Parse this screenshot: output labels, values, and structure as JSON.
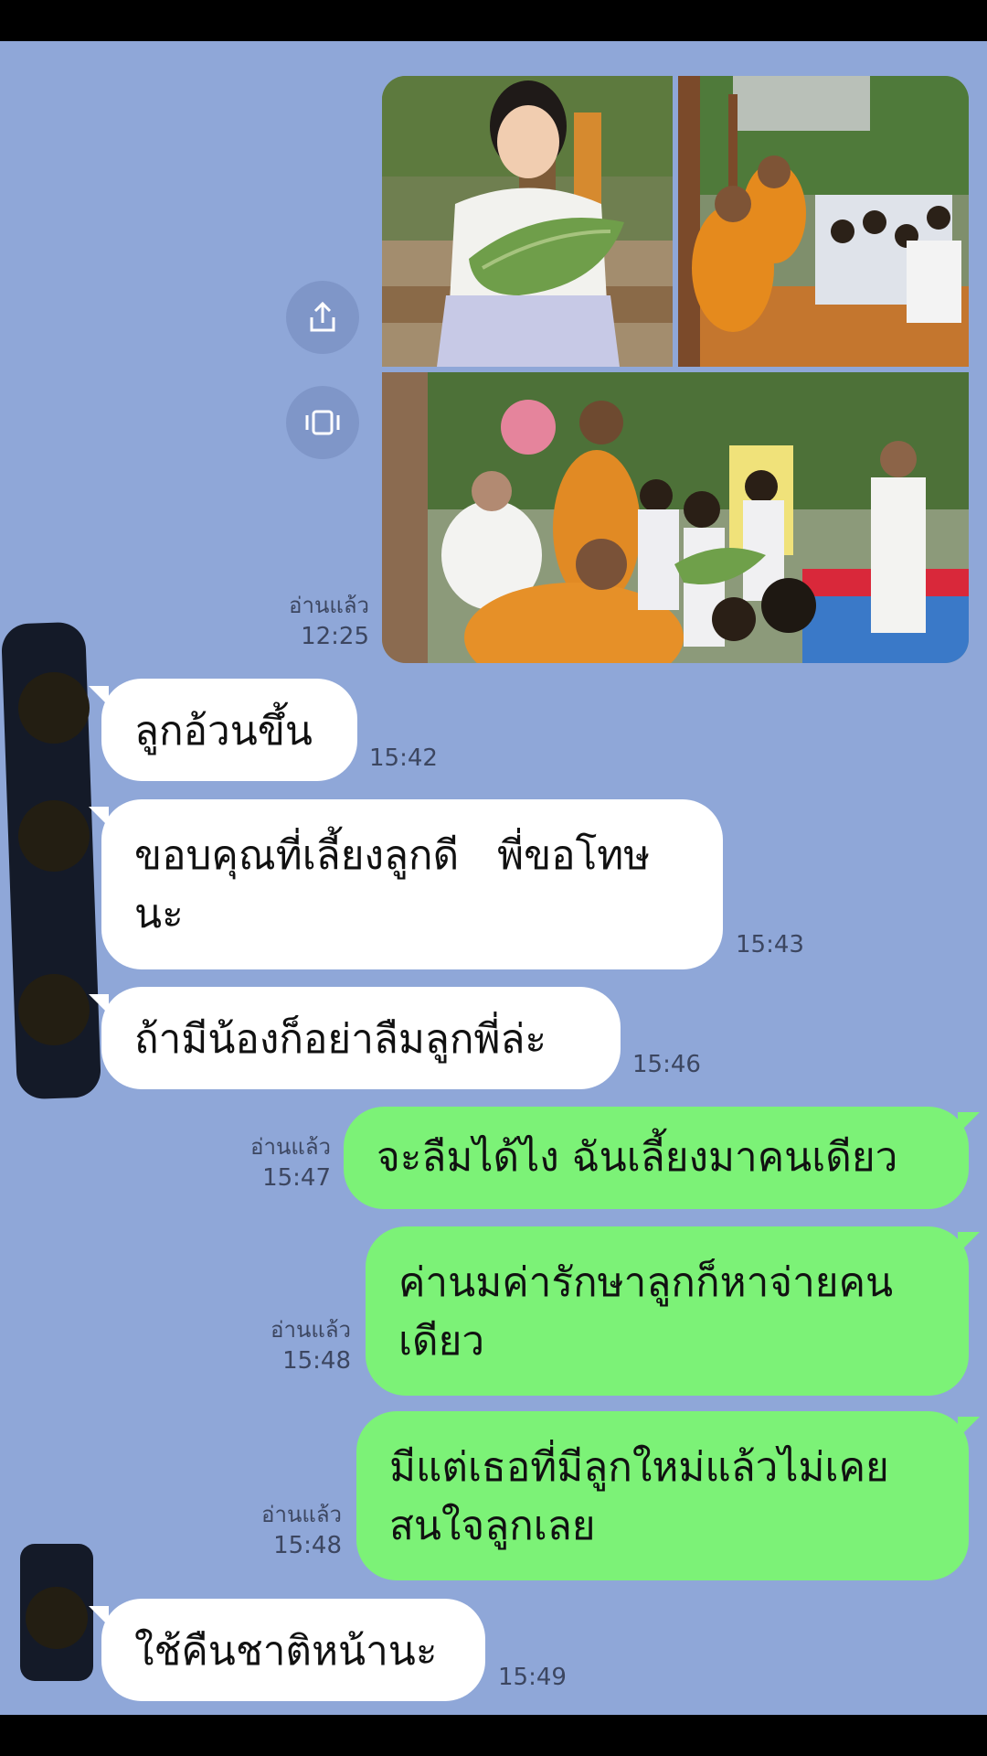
{
  "photo_message": {
    "read_label": "อ่านแล้ว",
    "time": "12:25",
    "actions": [
      {
        "icon": "share-icon"
      },
      {
        "icon": "album-icon"
      }
    ],
    "photos": [
      {
        "icon": "photo-girl-holding-leaf"
      },
      {
        "icon": "photo-monk-ceremony-1"
      },
      {
        "icon": "photo-monk-ceremony-2"
      }
    ]
  },
  "messages": [
    {
      "side": "in",
      "text": "ลูกอ้วนขึ้น",
      "time": "15:42"
    },
    {
      "side": "in",
      "lines": [
        "ขอบคุณที่เลี้ยงลูกดี   พี่ขอโทษ",
        "นะ"
      ],
      "time": "15:43"
    },
    {
      "side": "in",
      "text": "ถ้ามีน้องก็อย่าลืมลูกพี่ล่ะ",
      "time": "15:46"
    },
    {
      "side": "out",
      "text": "จะลืมได้ไง ฉันเลี้ยงมาคนเดียว",
      "read_label": "อ่านแล้ว",
      "time": "15:47"
    },
    {
      "side": "out",
      "lines": [
        "ค่านมค่ารักษาลูกก็หาจ่ายคน",
        "เดียว"
      ],
      "read_label": "อ่านแล้ว",
      "time": "15:48"
    },
    {
      "side": "out",
      "lines": [
        "มีแต่เธอที่มีลูกใหม่แล้วไม่เคย",
        "สนใจลูกเลย"
      ],
      "read_label": "อ่านแล้ว",
      "time": "15:48"
    },
    {
      "side": "in",
      "text": "ใช้คืนชาติหน้านะ",
      "time": "15:49"
    }
  ],
  "colors": {
    "chat_background": "#8fa7d8",
    "incoming_bubble": "#ffffff",
    "outgoing_bubble": "#7cf277",
    "timestamp_text": "#3c4660"
  }
}
